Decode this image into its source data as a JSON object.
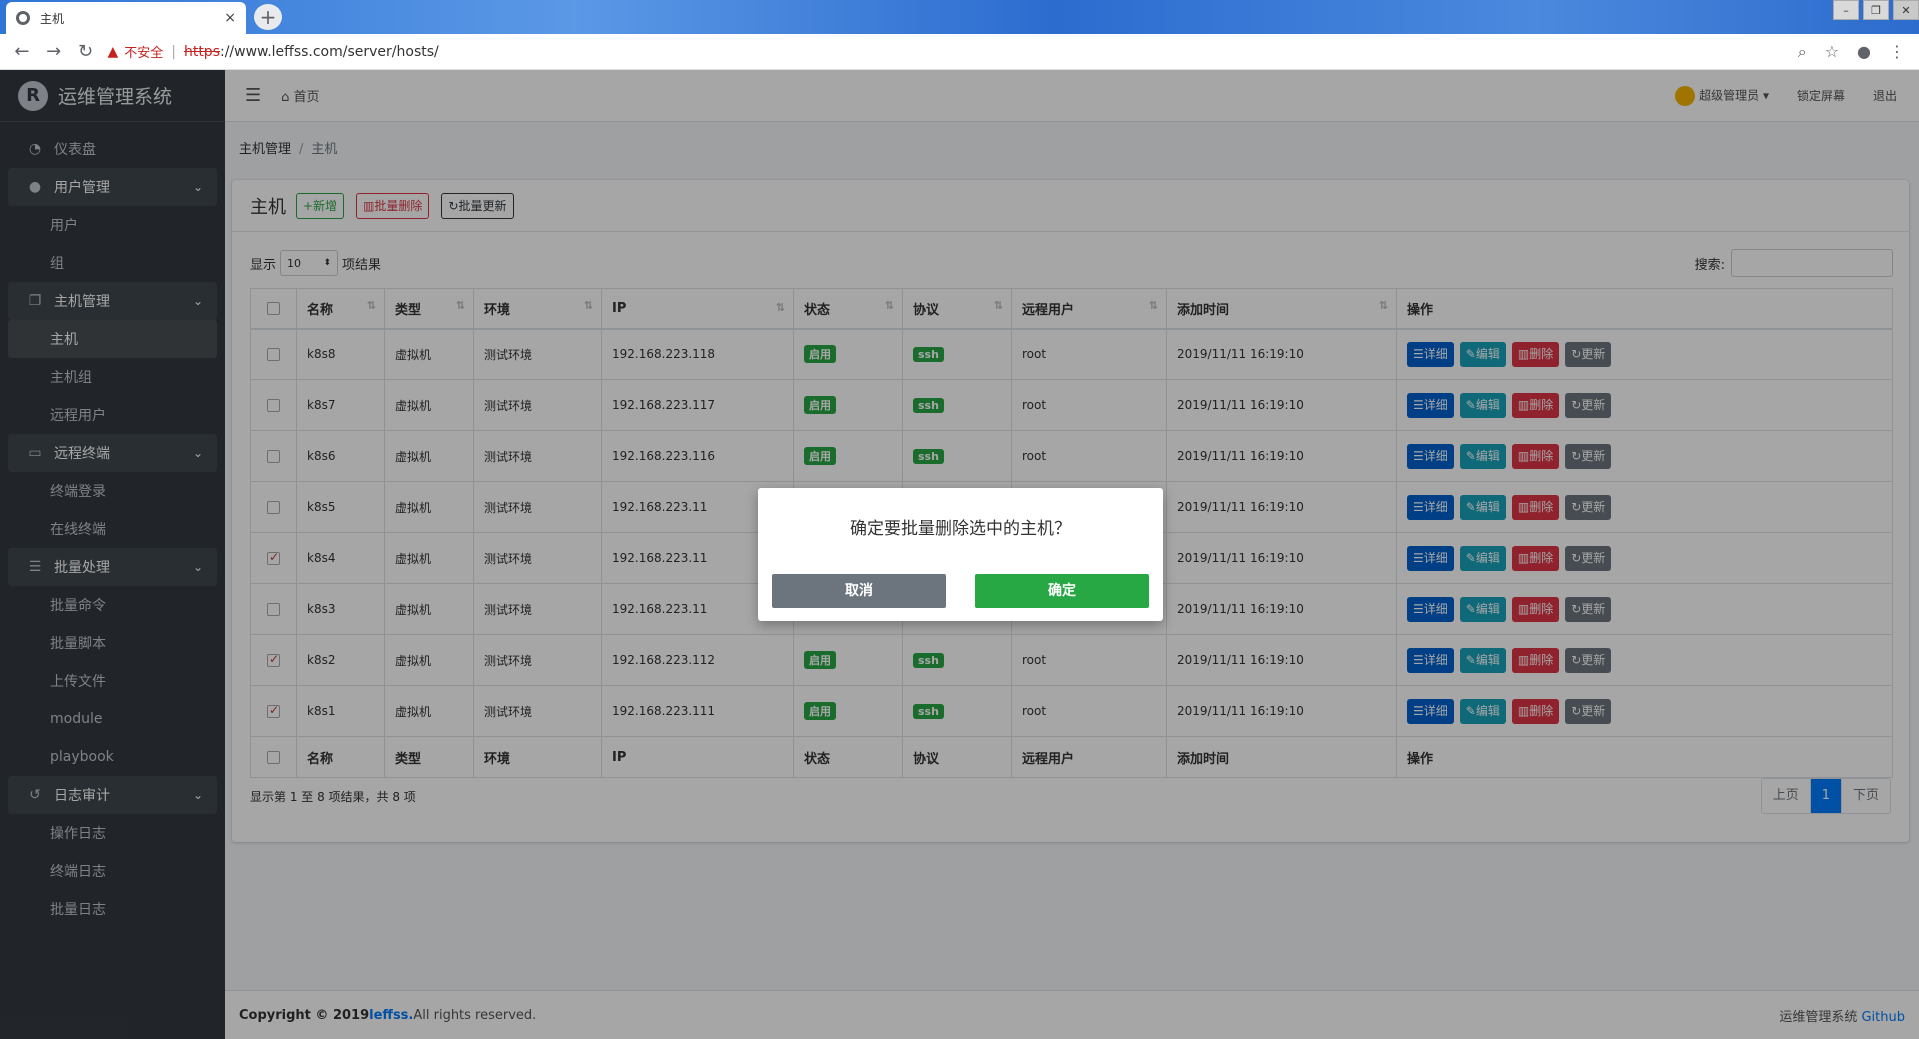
{
  "browser": {
    "tab_title": "主机",
    "insecure_label": "不安全",
    "url_scheme": "https",
    "url_rest": "://www.leffss.com/server/hosts/"
  },
  "sidebar": {
    "brand": "运维管理系统",
    "dashboard": "仪表盘",
    "groups": [
      {
        "label": "用户管理",
        "items": [
          "用户",
          "组"
        ]
      },
      {
        "label": "主机管理",
        "items": [
          "主机",
          "主机组",
          "远程用户"
        ]
      },
      {
        "label": "远程终端",
        "items": [
          "终端登录",
          "在线终端"
        ]
      },
      {
        "label": "批量处理",
        "items": [
          "批量命令",
          "批量脚本",
          "上传文件",
          "module",
          "playbook"
        ]
      },
      {
        "label": "日志审计",
        "items": [
          "操作日志",
          "终端日志",
          "批量日志"
        ]
      }
    ]
  },
  "topnav": {
    "home": "首页",
    "user": "超级管理员",
    "lock": "锁定屏幕",
    "logout": "退出"
  },
  "breadcrumb": {
    "parent": "主机管理",
    "current": "主机"
  },
  "card": {
    "title": "主机",
    "add": "+新增",
    "batch_delete": "批量删除",
    "batch_update": "批量更新"
  },
  "tools": {
    "show": "显示",
    "page_length": "10",
    "entries": "项结果",
    "search_label": "搜索:"
  },
  "table": {
    "headers": [
      "名称",
      "类型",
      "环境",
      "IP",
      "状态",
      "协议",
      "远程用户",
      "添加时间",
      "操作"
    ],
    "rows": [
      {
        "name": "k8s8",
        "type": "虚拟机",
        "env": "测试环境",
        "ip": "192.168.223.118",
        "status": "启用",
        "proto": "ssh",
        "user": "root",
        "time": "2019/11/11 16:19:10",
        "checked": false
      },
      {
        "name": "k8s7",
        "type": "虚拟机",
        "env": "测试环境",
        "ip": "192.168.223.117",
        "status": "启用",
        "proto": "ssh",
        "user": "root",
        "time": "2019/11/11 16:19:10",
        "checked": false
      },
      {
        "name": "k8s6",
        "type": "虚拟机",
        "env": "测试环境",
        "ip": "192.168.223.116",
        "status": "启用",
        "proto": "ssh",
        "user": "root",
        "time": "2019/11/11 16:19:10",
        "checked": false
      },
      {
        "name": "k8s5",
        "type": "虚拟机",
        "env": "测试环境",
        "ip": "192.168.223.11",
        "status": "",
        "proto": "",
        "user": "",
        "time": "2019/11/11 16:19:10",
        "checked": false
      },
      {
        "name": "k8s4",
        "type": "虚拟机",
        "env": "测试环境",
        "ip": "192.168.223.11",
        "status": "",
        "proto": "",
        "user": "",
        "time": "2019/11/11 16:19:10",
        "checked": true
      },
      {
        "name": "k8s3",
        "type": "虚拟机",
        "env": "测试环境",
        "ip": "192.168.223.11",
        "status": "",
        "proto": "",
        "user": "",
        "time": "2019/11/11 16:19:10",
        "checked": false
      },
      {
        "name": "k8s2",
        "type": "虚拟机",
        "env": "测试环境",
        "ip": "192.168.223.112",
        "status": "启用",
        "proto": "ssh",
        "user": "root",
        "time": "2019/11/11 16:19:10",
        "checked": true
      },
      {
        "name": "k8s1",
        "type": "虚拟机",
        "env": "测试环境",
        "ip": "192.168.223.111",
        "status": "启用",
        "proto": "ssh",
        "user": "root",
        "time": "2019/11/11 16:19:10",
        "checked": true
      }
    ],
    "actions": {
      "detail": "详细",
      "edit": "编辑",
      "delete": "删除",
      "update": "更新"
    }
  },
  "info": "显示第 1 至 8 项结果，共 8 项",
  "pager": {
    "prev": "上页",
    "page": "1",
    "next": "下页"
  },
  "footer": {
    "copyright": "Copyright © 2019 ",
    "brand_link": "leffss.",
    "rights": " All rights reserved.",
    "right_text": "运维管理系统 ",
    "github": "Github"
  },
  "modal": {
    "message": "确定要批量删除选中的主机？",
    "cancel": "取消",
    "confirm": "确定"
  },
  "colors": {
    "primary": "#007bff",
    "success": "#28a745",
    "danger": "#dc3545",
    "info": "#17a2b8",
    "sidebar": "#343a40"
  }
}
